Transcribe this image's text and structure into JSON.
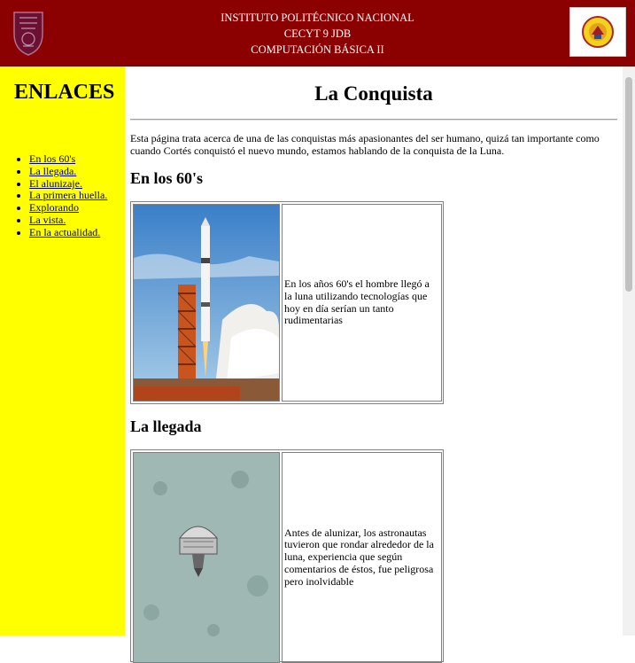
{
  "header": {
    "line1": "INSTITUTO POLITÉCNICO NACIONAL",
    "line2": "CECYT 9 JDB",
    "line3": "COMPUTACIÓN BÁSICA II",
    "color": "#8b0000"
  },
  "sidebar": {
    "title": "ENLACES",
    "color": "#ffff00",
    "links": [
      "En los 60's",
      "La llegada.",
      "El alunizaje.",
      "La primera huella.",
      "Explorando",
      "La vista.",
      "En la actualidad."
    ]
  },
  "main": {
    "title": "La Conquista",
    "intro": "Esta página trata acerca de una de las conquistas más apasionantes del ser humano, quizá tan importante como cuando Cortés conquistó el nuevo mundo, estamos hablando de la conquista de la Luna.",
    "sections": [
      {
        "title": "En los 60's",
        "text": "En los años 60's el hombre llegó a la luna utilizando tecnologías que hoy en día serían un tanto rudimentarias",
        "image": "rocket-launch-photo"
      },
      {
        "title": "La llegada",
        "text": "Antes de alunizar, los astronautas tuvieron que rondar alrededor de la luna, experiencia que según comentarios de éstos, fue peligrosa pero inolvidable",
        "image": "spacecraft-over-moon-photo"
      }
    ]
  }
}
